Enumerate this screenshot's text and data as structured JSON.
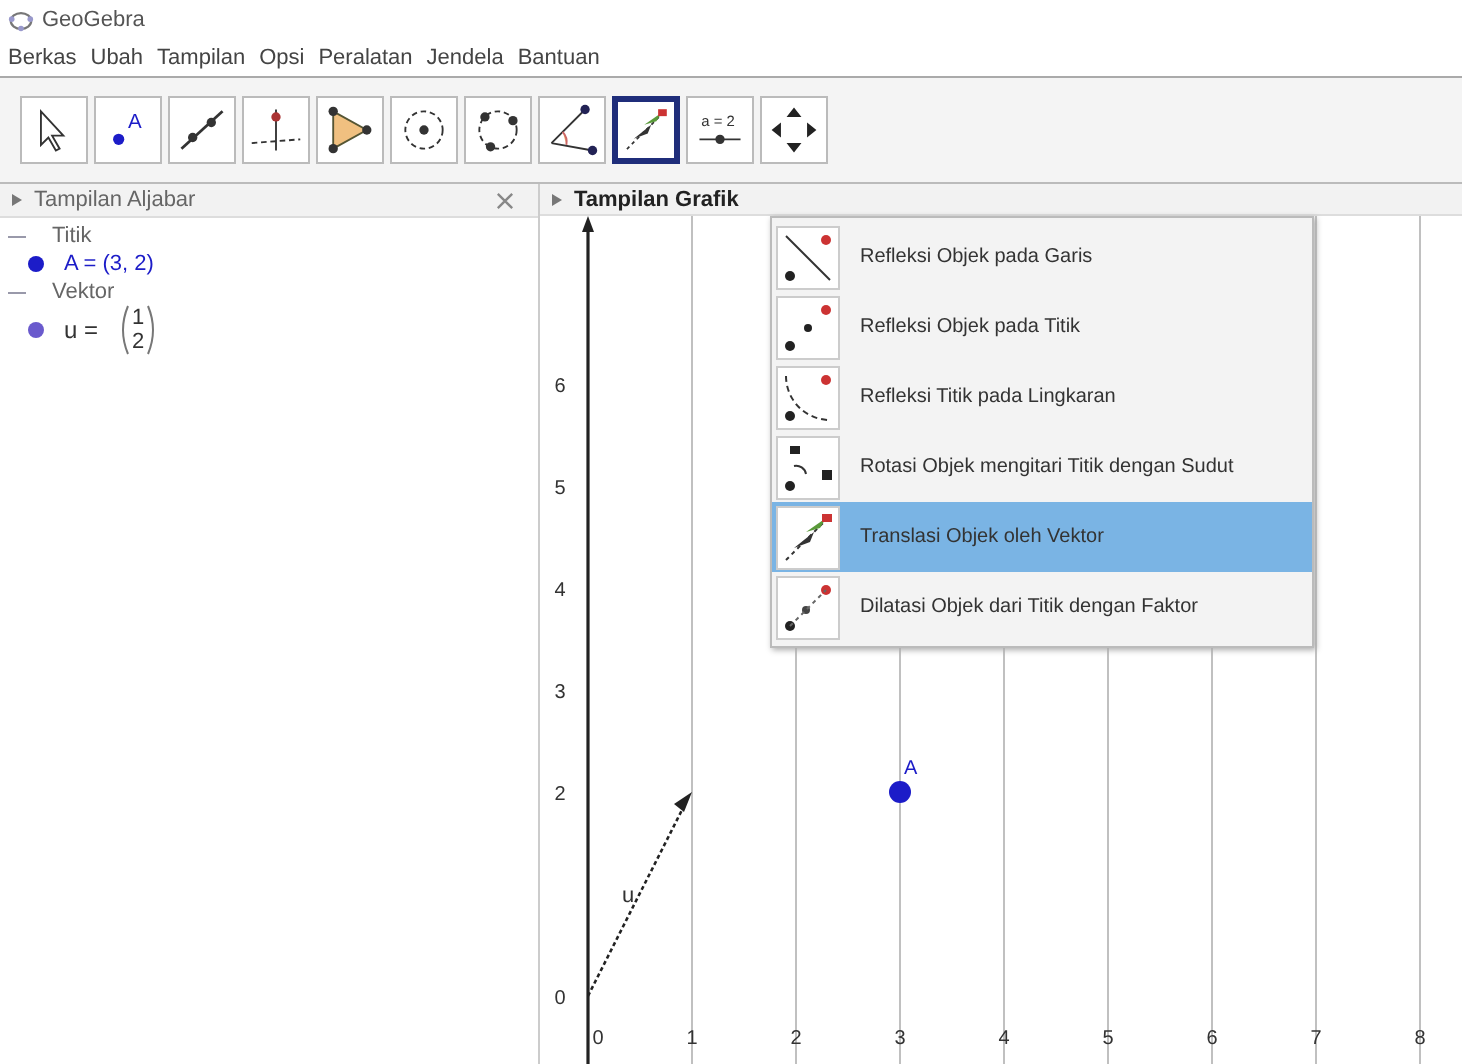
{
  "window": {
    "title": "GeoGebra"
  },
  "menu": [
    "Berkas",
    "Ubah",
    "Tampilan",
    "Opsi",
    "Peralatan",
    "Jendela",
    "Bantuan"
  ],
  "toolbar": [
    {
      "kind": "move",
      "selected": false
    },
    {
      "kind": "point",
      "text": "A",
      "selected": false
    },
    {
      "kind": "line",
      "selected": false
    },
    {
      "kind": "perpendicular",
      "selected": false
    },
    {
      "kind": "polygon",
      "selected": false
    },
    {
      "kind": "circle",
      "selected": false
    },
    {
      "kind": "circle3",
      "selected": false
    },
    {
      "kind": "angle",
      "selected": false
    },
    {
      "kind": "translate",
      "selected": true
    },
    {
      "kind": "slider",
      "text": "a = 2",
      "selected": false
    },
    {
      "kind": "pan",
      "selected": false
    }
  ],
  "algebra": {
    "title": "Tampilan Aljabar",
    "items": [
      {
        "label": "Titik",
        "expanded": true,
        "children": [
          {
            "kind": "point",
            "text": "A = (3, 2)",
            "color": "#1c1cc8"
          }
        ]
      },
      {
        "label": "Vektor",
        "expanded": true,
        "children": [
          {
            "kind": "vector",
            "text": "u =",
            "components": [
              "1",
              "2"
            ],
            "color": "#6a5acd"
          }
        ]
      }
    ]
  },
  "graphics": {
    "title": "Tampilan Grafik",
    "x_tick_labels": [
      "0",
      "1",
      "2",
      "3",
      "4",
      "5",
      "6",
      "7",
      "8"
    ],
    "y_tick_labels": [
      "6",
      "5",
      "4",
      "3",
      "2",
      "0"
    ],
    "point_label": "A",
    "vector_label": "u"
  },
  "dropdown": [
    {
      "kind": "reflect-line",
      "label": "Refleksi Objek pada Garis",
      "selected": false
    },
    {
      "kind": "reflect-point",
      "label": "Refleksi Objek pada Titik",
      "selected": false
    },
    {
      "kind": "reflect-circle",
      "label": "Refleksi Titik pada Lingkaran",
      "selected": false
    },
    {
      "kind": "rotate",
      "label": "Rotasi Objek mengitari Titik dengan Sudut",
      "selected": false
    },
    {
      "kind": "translate",
      "label": "Translasi Objek oleh Vektor",
      "selected": true
    },
    {
      "kind": "dilate",
      "label": "Dilatasi Objek dari Titik dengan Faktor",
      "selected": false
    }
  ]
}
